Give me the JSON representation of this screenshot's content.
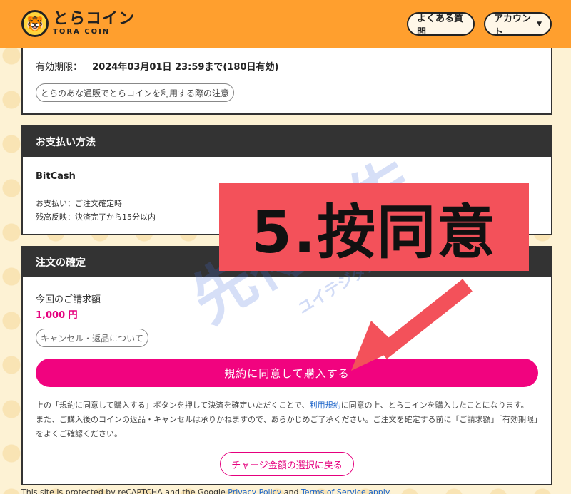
{
  "header": {
    "logo_text": "とらコイン",
    "logo_sub": "TORA COIN",
    "faq_label": "よくある質問",
    "account_label": "アカウント"
  },
  "expiry": {
    "label": "有効期限：",
    "value": "2024年03月01日 23:59まで(180日有効)",
    "notice_button": "とらのあな通販でとらコインを利用する際の注意"
  },
  "payment": {
    "heading": "お支払い方法",
    "method": "BitCash",
    "line1": "お支払い：ご注文確定時",
    "line2": "残高反映：決済完了から15分以内"
  },
  "confirm": {
    "heading": "注文の確定",
    "bill_label": "今回のご請求額",
    "bill_amount": "1,000 円",
    "cancel_button": "キャンセル・返品について",
    "buy_button": "規約に同意して購入する",
    "terms_part1": "上の「規約に同意して購入する」ボタンを押して決済を確定いただくことで、",
    "terms_link": "利用規約",
    "terms_part2": "に同意の上、とらコインを購入したことになります。",
    "terms_line2": "また、ご購入後のコインの返品・キャンセルは承りかねますので、あらかじめご了承ください。ご注文を確定する前に「ご請求額」「有効期限」をよくご確認ください。",
    "back_button": "チャージ金額の選択に戻る"
  },
  "footer": {
    "text": "This site is protected by reCAPTCHA and the Google",
    "privacy_link": "Privacy Policy",
    "and": "and",
    "terms_link": "Terms of Service apply."
  },
  "overlay": {
    "label": "5.按同意"
  },
  "watermark": {
    "main": "先得動佐",
    "sub": "ユイテジダルショップ"
  },
  "colors": {
    "header": "#ff9f2e",
    "accent": "#f1037f",
    "overlay_red": "#f3515a"
  }
}
